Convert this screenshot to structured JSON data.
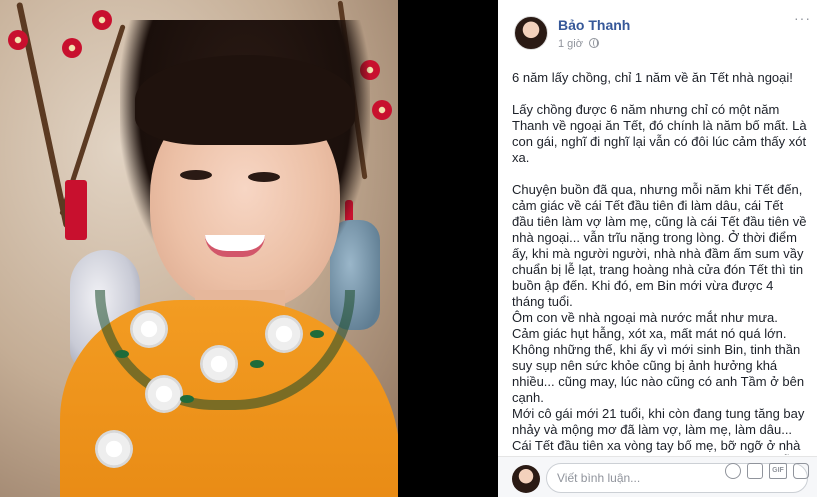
{
  "post": {
    "author": "Bảo Thanh",
    "time": "1 giờ",
    "caption_title": "6 năm lấy chồng, chỉ 1 năm về ăn Tết nhà ngoại!",
    "paragraphs": [
      "Lấy chồng được 6 năm nhưng chỉ có một năm Thanh về ngoại ăn Tết, đó chính là năm bố mất. Là con gái, nghĩ đi nghĩ lại vẫn có đôi lúc cảm thấy xót xa.",
      "Chuyện buồn đã qua, nhưng mỗi năm khi Tết đến, cảm giác về cái Tết đầu tiên đi làm dâu, cái Tết đầu tiên làm vợ làm mẹ, cũng là cái Tết đầu tiên về nhà ngoại... vẫn trĩu nặng trong lòng. Ở thời điểm ấy, khi mà người người, nhà nhà đầm ấm sum vầy chuẩn bị lễ lạt, trang hoàng nhà cửa đón Tết thì tin buồn ập đến. Khi đó, em Bin mới vừa được 4 tháng tuổi.",
      "Ôm con về nhà ngoại mà nước mắt như mưa. Cảm giác hụt hẫng, xót xa, mất mát nó quá lớn. Không những thế, khi ấy vì mới sinh Bin, tinh thần suy sụp nên sức khỏe cũng bị ảnh hưởng khá nhiều... cũng may, lúc nào cũng có anh Tầm ở bên cạnh.",
      "Mới cô gái mới 21 tuổi, khi còn đang tung tăng bay nhảy và mộng mơ đã làm vợ, làm mẹ, làm dâu...",
      "Cái Tết đầu tiên xa vòng tay bố mẹ, bỡ ngỡ ở nhà chồng và ôm con nhỏ, cảm giác chưa hết hụt hẫng thì lại nhận tin buồn. Tết nhà ngoại khi ấy thật sự đáng nhớ..."
    ]
  },
  "comment": {
    "placeholder": "Viết bình luận..."
  },
  "icons": {
    "more": "more-icon",
    "globe": "globe-icon",
    "emoji": "emoji-icon",
    "camera": "camera-icon",
    "gif": "gif-icon",
    "sticker": "sticker-icon"
  },
  "colors": {
    "author": "#365899",
    "muted": "#90949c",
    "dress": "#f39c22"
  }
}
